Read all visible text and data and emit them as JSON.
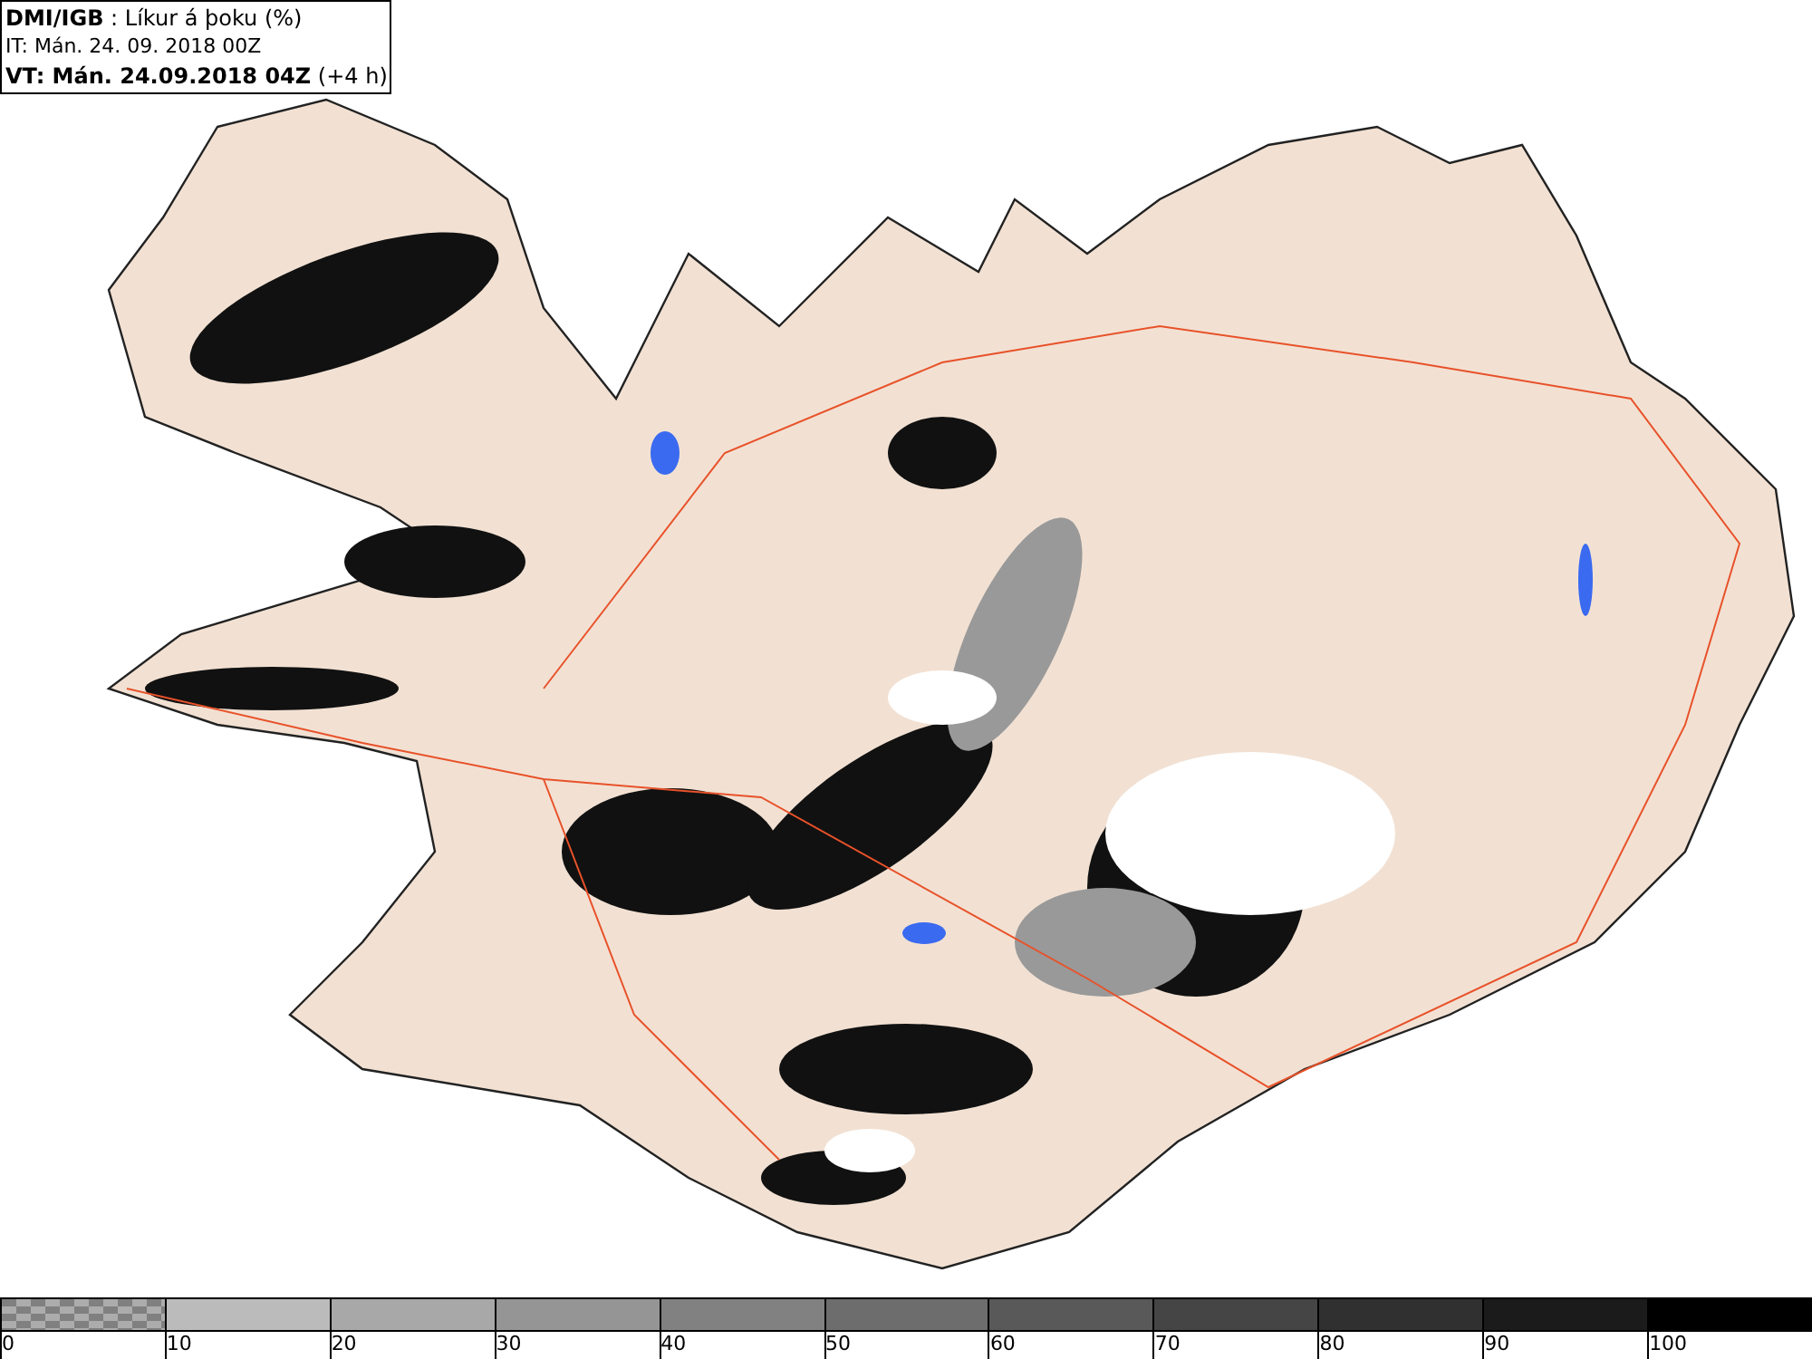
{
  "title_box": {
    "lines": [
      "**DMI/IGB** : Líkur á þoku (%)",
      "IT: Mán. 24. 09. 2018 00Z",
      "**VT: Mán. 24.09.2018 04Z** (+4 h)"
    ]
  },
  "legend": {
    "bins": [
      {
        "kind": "checker",
        "color": "#808080"
      },
      {
        "kind": "solid",
        "color": "#bbbbbb"
      },
      {
        "kind": "solid",
        "color": "#a8a8a8"
      },
      {
        "kind": "solid",
        "color": "#959595"
      },
      {
        "kind": "solid",
        "color": "#818181"
      },
      {
        "kind": "solid",
        "color": "#6d6d6d"
      },
      {
        "kind": "solid",
        "color": "#595959"
      },
      {
        "kind": "solid",
        "color": "#454545"
      },
      {
        "kind": "solid",
        "color": "#303030"
      },
      {
        "kind": "solid",
        "color": "#1b1b1b"
      },
      {
        "kind": "solid",
        "color": "#000000"
      }
    ],
    "ticks": [
      "0",
      "10",
      "20",
      "30",
      "40",
      "50",
      "60",
      "70",
      "80",
      "90",
      "100"
    ]
  }
}
